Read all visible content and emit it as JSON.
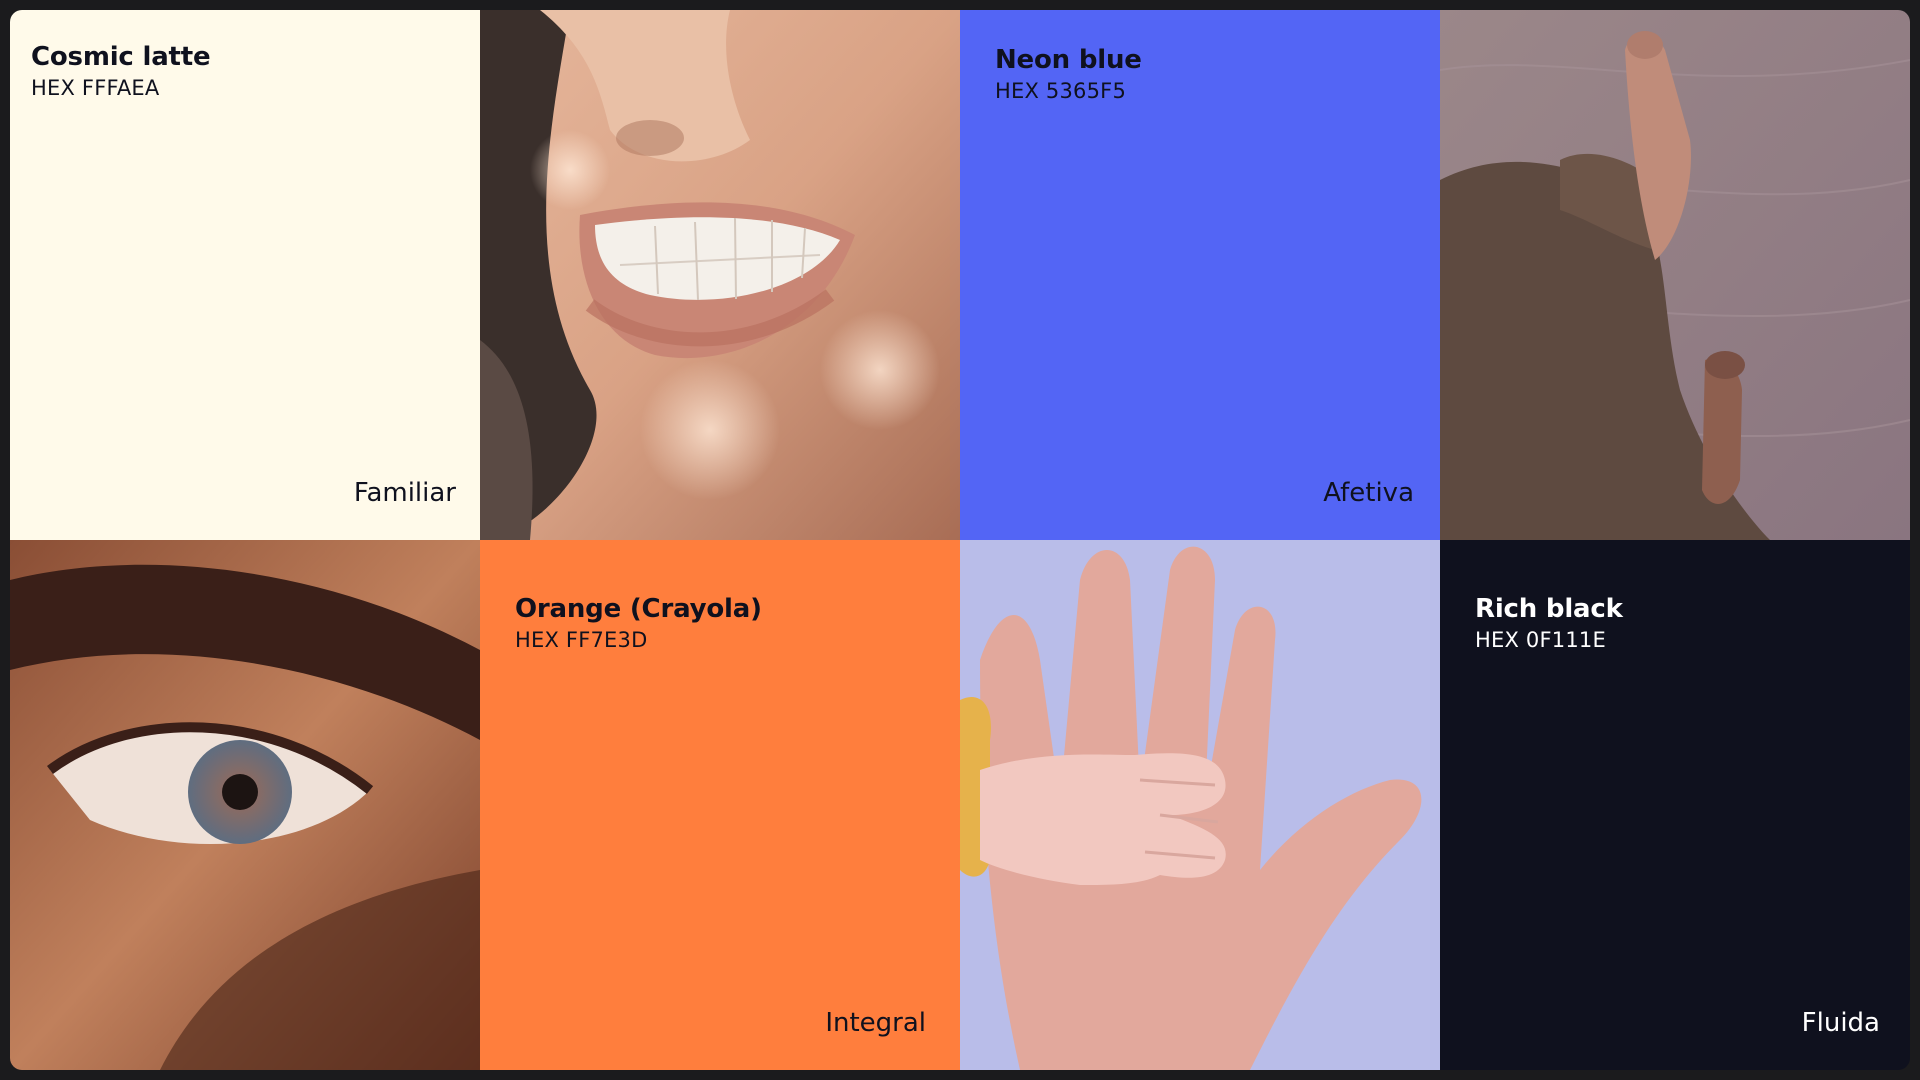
{
  "swatches": [
    {
      "name": "Cosmic latte",
      "hex": "HEX FFFAEA",
      "word": "Familiar",
      "color": "#FFFAEA",
      "text_color": "#0F111E"
    },
    {
      "name": "Neon blue",
      "hex": "HEX 5365F5",
      "word": "Afetiva",
      "color": "#5365F5",
      "text_color": "#0F111E"
    },
    {
      "name": "Orange (Crayola)",
      "hex": "HEX FF7E3D",
      "word": "Integral",
      "color": "#FF7E3D",
      "text_color": "#0F111E"
    },
    {
      "name": "Rich black",
      "hex": "HEX 0F111E",
      "word": "Fluida",
      "color": "#0F111E",
      "text_color": "#FFFFFF"
    }
  ],
  "photos": [
    {
      "icon": "smiling-mouth-photo"
    },
    {
      "icon": "bare-feet-on-sand-photo"
    },
    {
      "icon": "close-up-eye-photo"
    },
    {
      "icon": "baby-hand-on-adult-hand-photo"
    }
  ]
}
